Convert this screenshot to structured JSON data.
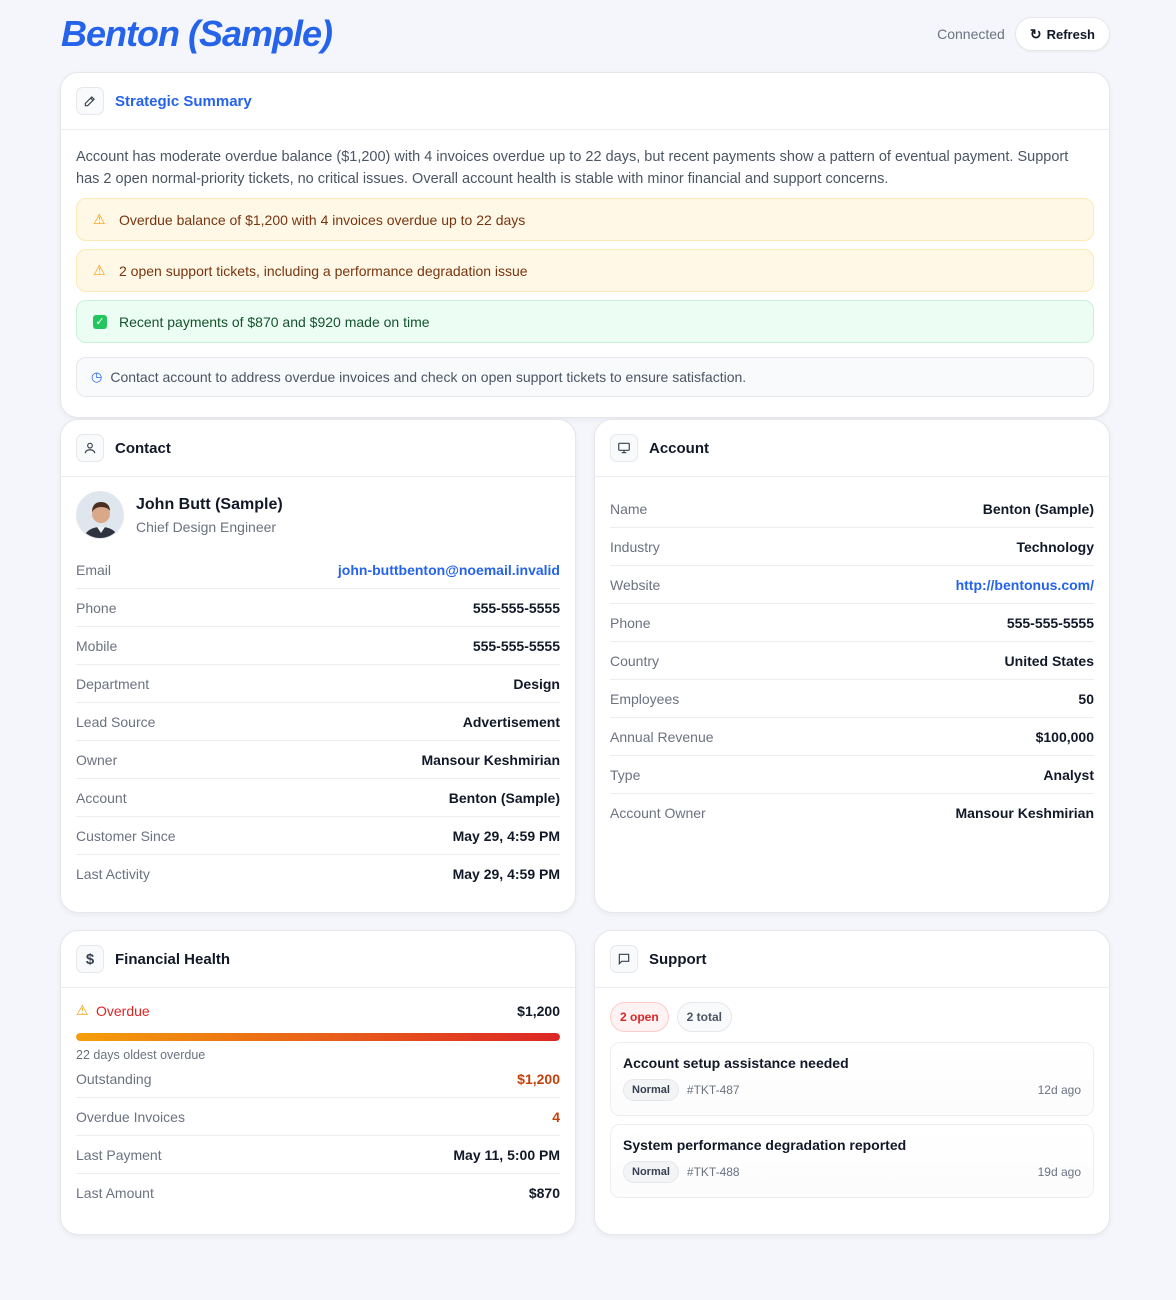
{
  "header": {
    "title": "Benton (Sample)",
    "status": "Connected",
    "refresh_label": "Refresh"
  },
  "summary": {
    "title": "Strategic Summary",
    "text": "Account has moderate overdue balance ($1,200) with 4 invoices overdue up to 22 days, but recent payments show a pattern of eventual payment. Support has 2 open normal-priority tickets, no critical issues. Overall account health is stable with minor financial and support concerns.",
    "alerts": [
      {
        "type": "warning",
        "text": "Overdue balance of $1,200 with 4 invoices overdue up to 22 days"
      },
      {
        "type": "warning",
        "text": "2 open support tickets, including a performance degradation issue"
      },
      {
        "type": "success",
        "text": "Recent payments of $870 and $920 made on time"
      }
    ],
    "recommendation": "Contact account to address overdue invoices and check on open support tickets to ensure satisfaction."
  },
  "contact": {
    "title": "Contact",
    "name": "John Butt (Sample)",
    "job_title": "Chief Design Engineer",
    "fields": [
      {
        "label": "Email",
        "value": "john-buttbenton@noemail.invalid"
      },
      {
        "label": "Phone",
        "value": "555-555-5555"
      },
      {
        "label": "Mobile",
        "value": "555-555-5555"
      },
      {
        "label": "Department",
        "value": "Design"
      },
      {
        "label": "Lead Source",
        "value": "Advertisement"
      },
      {
        "label": "Owner",
        "value": "Mansour Keshmirian"
      },
      {
        "label": "Account",
        "value": "Benton (Sample)"
      },
      {
        "label": "Customer Since",
        "value": "May 29, 4:59 PM"
      },
      {
        "label": "Last Activity",
        "value": "May 29, 4:59 PM"
      }
    ]
  },
  "account": {
    "title": "Account",
    "fields": [
      {
        "label": "Name",
        "value": "Benton (Sample)"
      },
      {
        "label": "Industry",
        "value": "Technology"
      },
      {
        "label": "Website",
        "value": "http://bentonus.com/"
      },
      {
        "label": "Phone",
        "value": "555-555-5555"
      },
      {
        "label": "Country",
        "value": "United States"
      },
      {
        "label": "Employees",
        "value": "50"
      },
      {
        "label": "Annual Revenue",
        "value": "$100,000"
      },
      {
        "label": "Type",
        "value": "Analyst"
      },
      {
        "label": "Account Owner",
        "value": "Mansour Keshmirian"
      }
    ]
  },
  "financial": {
    "title": "Financial Health",
    "overdue_label": "Overdue",
    "overdue_value": "$1,200",
    "overdue_progress": 1.0,
    "oldest_note": "22 days oldest overdue",
    "fields": [
      {
        "label": "Outstanding",
        "value": "$1,200"
      },
      {
        "label": "Overdue Invoices",
        "value": "4"
      },
      {
        "label": "Last Payment",
        "value": "May 11, 5:00 PM"
      },
      {
        "label": "Last Amount",
        "value": "$870"
      }
    ]
  },
  "support": {
    "title": "Support",
    "open_badge": "2 open",
    "total_badge": "2 total",
    "tickets": [
      {
        "title": "Account setup assistance needed",
        "priority": "Normal",
        "id": "#TKT-487",
        "age": "12d ago"
      },
      {
        "title": "System performance degradation reported",
        "priority": "Normal",
        "id": "#TKT-488",
        "age": "19d ago"
      }
    ]
  },
  "colors": {
    "accent": "#2563eb",
    "warning_bg": "#fff8e6",
    "success_bg": "#ecfdf3",
    "danger": "#dc2626",
    "orange": "#c2410c"
  }
}
